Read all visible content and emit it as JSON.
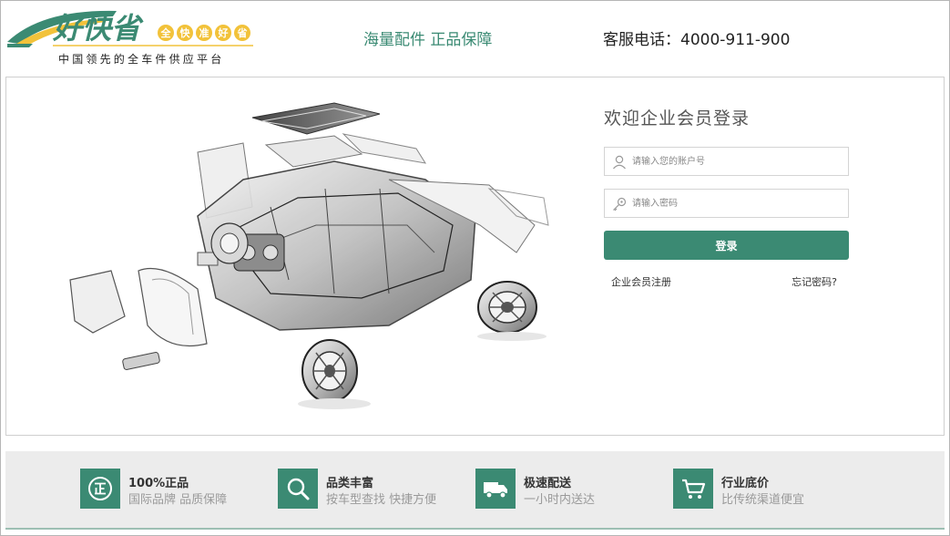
{
  "header": {
    "logo_text": "好快省",
    "logo_badge_chars": [
      "全",
      "快",
      "准",
      "好",
      "省"
    ],
    "logo_subtitle": "中国领先的全车件供应平台",
    "slogan": "海量配件 正品保障",
    "hotline": "客服电话：4000-911-900"
  },
  "login": {
    "title": "欢迎企业会员登录",
    "account_placeholder": "请输入您的账户号",
    "password_placeholder": "请输入密码",
    "submit_label": "登录",
    "register_link": "企业会员注册",
    "forgot_link": "忘记密码?"
  },
  "features": [
    {
      "icon": "genuine-icon",
      "title": "100%正品",
      "subtitle": "国际品牌 品质保障"
    },
    {
      "icon": "search-icon",
      "title": "品类丰富",
      "subtitle": "按车型查找 快捷方便"
    },
    {
      "icon": "truck-icon",
      "title": "极速配送",
      "subtitle": "一小时内送达"
    },
    {
      "icon": "cart-icon",
      "title": "行业底价",
      "subtitle": "比传统渠道便宜"
    }
  ],
  "colors": {
    "brand_green": "#3b8a73",
    "logo_yellow": "#f2c23a",
    "feature_bar_bg": "#ececec"
  }
}
